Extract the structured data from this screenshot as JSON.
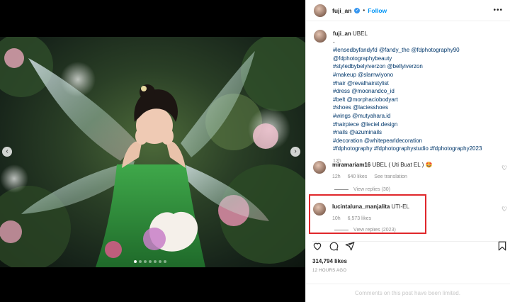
{
  "post": {
    "username": "fuji_an",
    "follow_label": "Follow",
    "separator": "•",
    "more": "•••"
  },
  "caption": {
    "username": "fuji_an",
    "text": "UBEL",
    "dash": "-",
    "lines": [
      "#lensedbyfandyfd @fandy_the @fdphotography90",
      "@fdphotographybeauty",
      "#styledbybelyiverzon @bellyiverzon",
      "#makeup @slamwiyono",
      "#hair @revalhairstylist",
      "#dress @moonandco_id",
      "#belt @morphaciobodyart",
      "#shoes @laciesshoes",
      "#wings @mutyahara.id",
      "#hairpiece @leciel.design",
      "#nails @azuminails",
      "#decoration @whitepearldecoration",
      "#fdphotography #fdphotographystudio #fdphotography2023"
    ],
    "time": "12h"
  },
  "comments": [
    {
      "username": "miramariam16",
      "text": "UBEL ( Uti Buat EL ) 🤩",
      "time": "12h",
      "likes": "640 likes",
      "action": "See translation",
      "replies": "View replies (30)"
    },
    {
      "username": "lucintaluna_manjalita",
      "text": "UTI-EL",
      "time": "10h",
      "likes": "6,573 likes",
      "replies": "View replies (2023)"
    }
  ],
  "footer": {
    "likes": "314,794 likes",
    "ago": "12 HOURS AGO",
    "limited": "Comments on this post have been limited."
  },
  "icons": {
    "heart": "heart-icon",
    "comment": "comment-icon",
    "share": "share-icon",
    "save": "bookmark-icon"
  },
  "colors": {
    "link": "#00376b",
    "follow": "#0095f6",
    "highlight": "#e0272b"
  }
}
